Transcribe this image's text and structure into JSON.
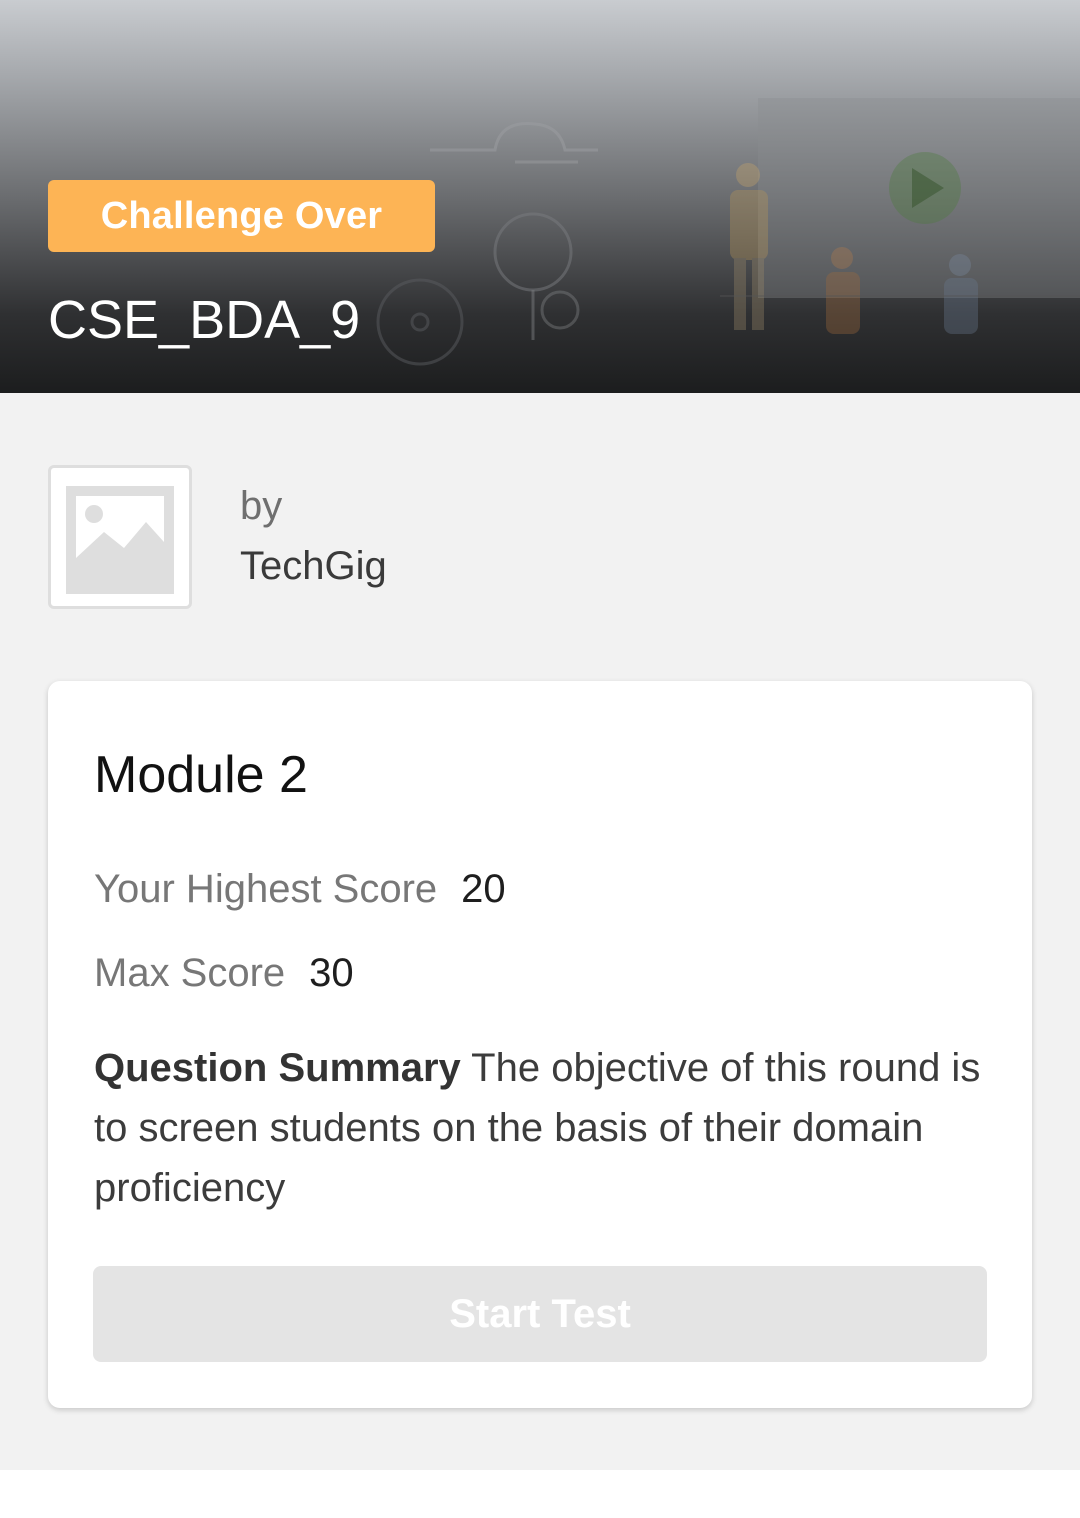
{
  "header": {
    "status_badge": "Challenge Over",
    "challenge_title": "CSE_BDA_9"
  },
  "organizer": {
    "by_label": "by",
    "name": "TechGig",
    "logo_icon": "image-placeholder-icon"
  },
  "module": {
    "title": "Module 2",
    "highest_score_label": "Your Highest Score",
    "highest_score_value": "20",
    "max_score_label": "Max Score",
    "max_score_value": "30",
    "summary_label": "Question Summary",
    "summary_text": "The objective of this round is to screen students on the basis of their domain proficiency",
    "start_button_label": "Start Test"
  },
  "colors": {
    "badge": "#fdb455",
    "button_disabled": "#e4e4e4",
    "page_background": "#f2f2f2"
  }
}
